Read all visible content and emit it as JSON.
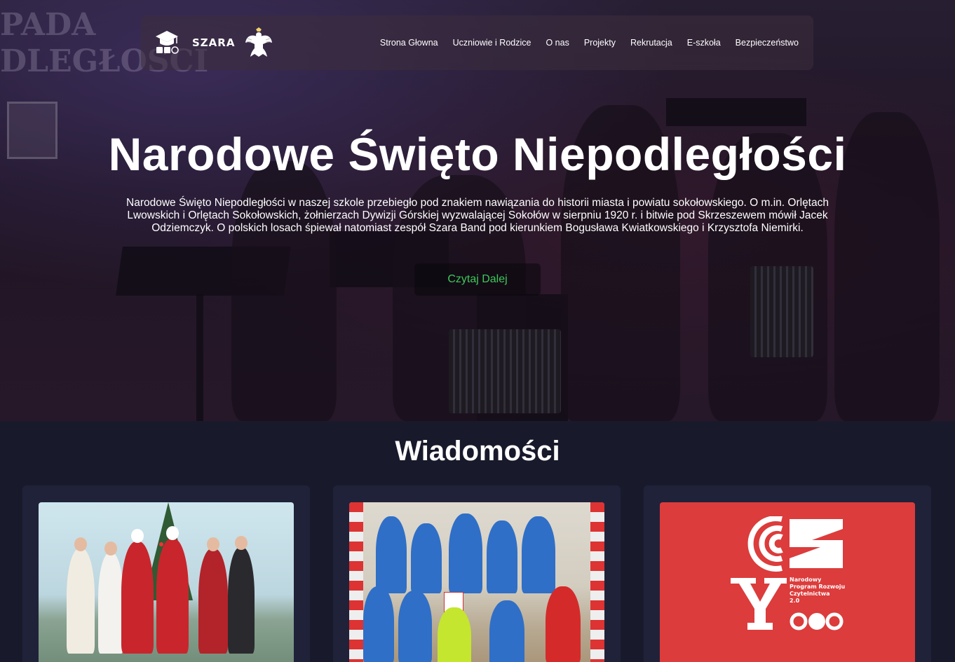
{
  "nav": {
    "logo_text": "SZARA",
    "links": [
      "Strona Głowna",
      "Uczniowie i Rodzice",
      "O nas",
      "Projekty",
      "Rekrutacja",
      "E-szkoła",
      "Bezpieczeństwo"
    ]
  },
  "hero": {
    "banner_text_line1": "PADA",
    "banner_text_line2": "DLEGŁOŚCI",
    "title": "Narodowe Święto Niepodległości",
    "description": "Narodowe Święto Niepodległości w naszej szkole przebiegło pod znakiem nawiązania do historii miasta i powiatu sokołowskiego. O m.in. Orlętach Lwowskich i Orlętach Sokołowskich, żołnierzach Dywizji Górskiej wyzwalającej Sokołów w sierpniu 1920 r. i bitwie pod Skrzeszewem mówił Jacek Odziemczyk. O polskich losach śpiewał natomiast zespół Szara Band pod kierunkiem Bogusława Kwiatkowskiego i Krzysztofa Niemirki.",
    "button_label": "Czytaj Dalej"
  },
  "news": {
    "title": "Wiadomości",
    "cards": [
      {
        "image": "christmas-group-photo"
      },
      {
        "image": "sports-team-photo"
      },
      {
        "image": "nprc-logo",
        "logo_text": [
          "Narodowy",
          "Program Rozwoju",
          "Czytelnictwa",
          "2.0"
        ]
      }
    ]
  },
  "colors": {
    "background": "#181a2b",
    "card_bg": "#20223a",
    "button_text": "#3ec85a",
    "nprc_red": "#dc3c3c"
  }
}
